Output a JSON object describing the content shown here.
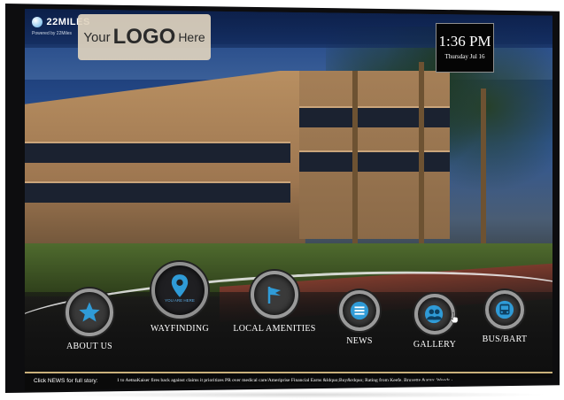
{
  "brand": {
    "name": "22MILES",
    "sub": "Powered by 22Miles"
  },
  "logo": {
    "part1": "Your",
    "part2": "LOGO",
    "part3": "Here"
  },
  "clock": {
    "time": "1:36 PM",
    "date": "Thursday Jul 16"
  },
  "nav": [
    {
      "label": "ABOUT US",
      "icon": "star-icon"
    },
    {
      "label": "YOU ARE HERE",
      "icon": "location-pin-icon"
    },
    {
      "label": "WAYFINDING",
      "icon": ""
    },
    {
      "label": "LOCAL AMENITIES",
      "icon": "flag-icon"
    },
    {
      "label": "NEWS",
      "icon": "news-list-icon"
    },
    {
      "label": "GALLERY",
      "icon": "people-icon"
    },
    {
      "label": "BUS/BART",
      "icon": "bus-icon"
    }
  ],
  "ticker": {
    "label": "Click NEWS for full story:",
    "text": "1 to AetnaKaiser fires back against claims it prioritizes PR over medical care/Ameriprise Financial Earns &ldquo;Buy&rdquo; Rating from Keefe, Bruyette &amp; Woods ›"
  },
  "colors": {
    "accent": "#2f9bd7",
    "gold": "#c9b07a",
    "bezel": "#0d0d0f"
  }
}
